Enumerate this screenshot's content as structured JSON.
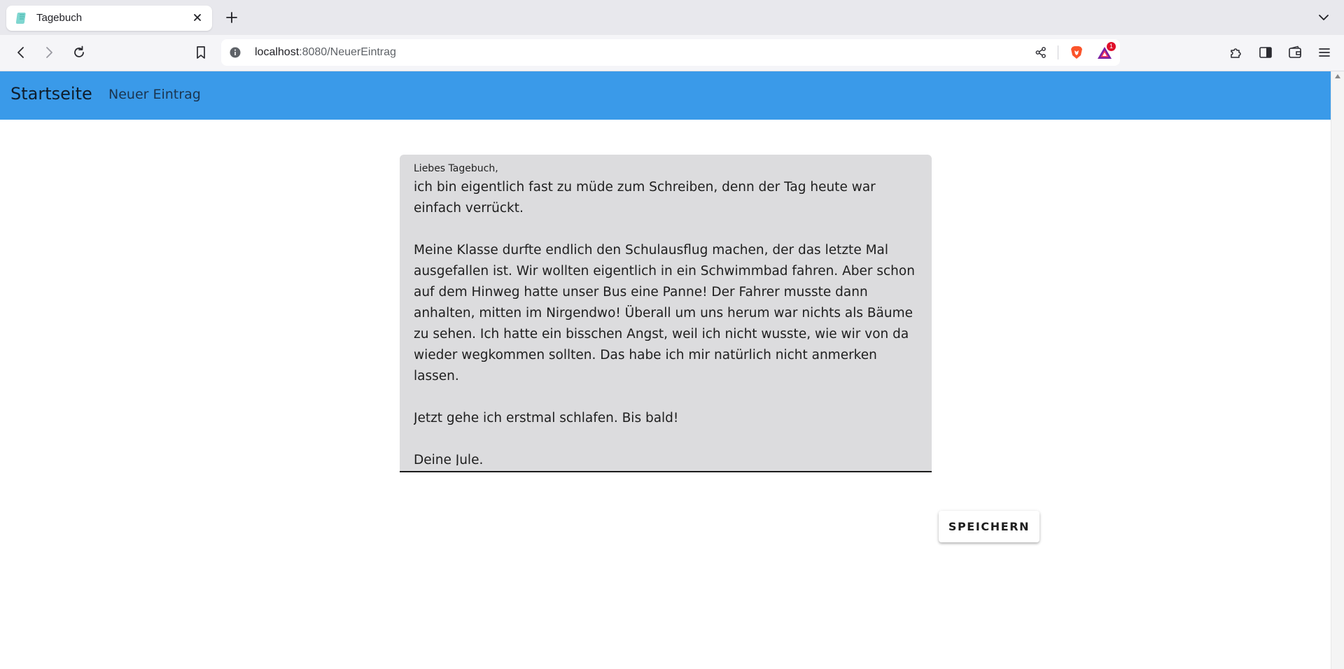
{
  "browser": {
    "tab_title": "Tagebuch",
    "url_host": "localhost",
    "url_rest": ":8080/NeuerEintrag",
    "rewards_badge": "1",
    "icons": [
      "favicon-icon",
      "close-icon",
      "plus-icon",
      "chevron-down-icon",
      "back-icon",
      "forward-icon",
      "reload-icon",
      "bookmark-icon",
      "info-icon",
      "share-icon",
      "brave-shield-icon",
      "brave-rewards-icon",
      "extensions-icon",
      "sidebar-icon",
      "wallet-icon",
      "menu-icon"
    ]
  },
  "appbar": {
    "brand": "Startseite",
    "nav_new_entry": "Neuer Eintrag",
    "color": "#3a9ae9"
  },
  "entry": {
    "label": "Liebes Tagebuch,",
    "text": "ich bin eigentlich fast zu müde zum Schreiben, denn der Tag heute war einfach verrückt.\n\nMeine Klasse durfte endlich den Schulausflug machen, der das letzte Mal ausgefallen ist. Wir wollten eigentlich in ein Schwimmbad fahren. Aber schon auf dem Hinweg hatte unser Bus eine Panne! Der Fahrer musste dann anhalten, mitten im Nirgendwo! Überall um uns herum war nichts als Bäume zu sehen. Ich hatte ein bisschen Angst, weil ich nicht wusste, wie wir von da wieder wegkommen sollten. Das habe ich mir natürlich nicht anmerken lassen.\n\nJetzt gehe ich erstmal schlafen. Bis bald!\n\nDeine Jule."
  },
  "actions": {
    "save_label": "SPEICHERN"
  }
}
